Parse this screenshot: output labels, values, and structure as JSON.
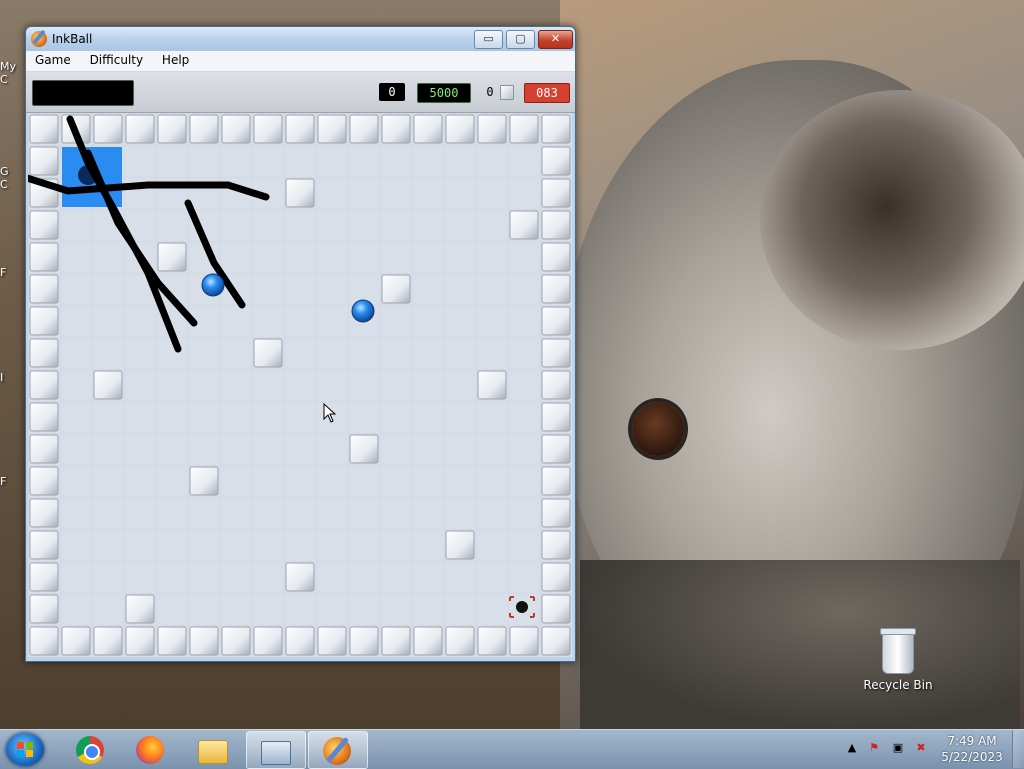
{
  "desktop": {
    "recycle_bin_label": "Recycle Bin",
    "left_partial_labels": [
      "My C",
      "G",
      "C",
      "F",
      "I",
      "F"
    ]
  },
  "window": {
    "title": "InkBall",
    "menu": [
      "Game",
      "Difficulty",
      "Help"
    ],
    "controls": {
      "minimize": "▭",
      "maximize": "▢",
      "close": "✕"
    }
  },
  "status": {
    "score": "0",
    "high_score": "5000",
    "balls_remaining": "0",
    "timer": "083"
  },
  "board": {
    "background": "#d9dfe9",
    "tile_color": "#e8ebf0",
    "ball_color": "#1a76d6",
    "ink_color": "#000000",
    "hole_color": "#2a8cf0"
  },
  "taskbar": {
    "apps": [
      "Chrome",
      "Firefox",
      "Windows Explorer",
      "On-Screen Keyboard",
      "InkBall"
    ],
    "clock_time": "7:49 AM",
    "clock_date": "5/22/2023"
  }
}
